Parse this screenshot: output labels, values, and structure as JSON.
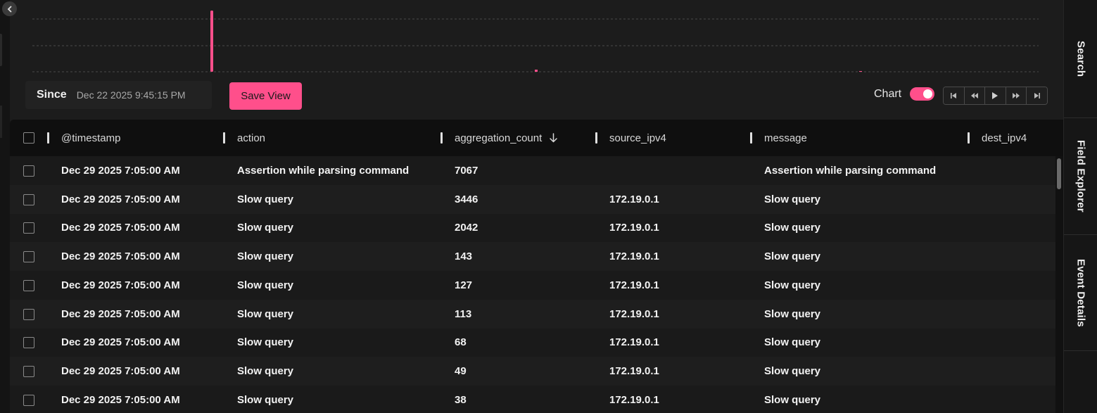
{
  "right_panel": {
    "tabs": [
      "Search",
      "Field Explorer",
      "Event Details"
    ]
  },
  "toolbar": {
    "since_label": "Since",
    "since_value": "Dec 22 2025 9:45:15 PM",
    "save_view_label": "Save View",
    "chart_label": "Chart",
    "chart_enabled": true,
    "player_controls": [
      "skip-back-icon",
      "rewind-icon",
      "play-icon",
      "fast-forward-icon",
      "skip-forward-icon"
    ]
  },
  "colors": {
    "accent": "#ff4f8b",
    "background": "#1c1c1c",
    "header_bg": "#0f0f0f"
  },
  "table": {
    "columns": [
      "@timestamp",
      "action",
      "aggregation_count",
      "source_ipv4",
      "message",
      "dest_ipv4"
    ],
    "sorted_column": "aggregation_count",
    "sort_direction": "descending",
    "rows": [
      {
        "timestamp": "Dec 29 2025 7:05:00 AM",
        "action": "Assertion while parsing command",
        "aggregation_count": "7067",
        "source_ipv4": "",
        "message": "Assertion while parsing command",
        "dest_ipv4": ""
      },
      {
        "timestamp": "Dec 29 2025 7:05:00 AM",
        "action": "Slow query",
        "aggregation_count": "3446",
        "source_ipv4": "172.19.0.1",
        "message": "Slow query",
        "dest_ipv4": ""
      },
      {
        "timestamp": "Dec 29 2025 7:05:00 AM",
        "action": "Slow query",
        "aggregation_count": "2042",
        "source_ipv4": "172.19.0.1",
        "message": "Slow query",
        "dest_ipv4": ""
      },
      {
        "timestamp": "Dec 29 2025 7:05:00 AM",
        "action": "Slow query",
        "aggregation_count": "143",
        "source_ipv4": "172.19.0.1",
        "message": "Slow query",
        "dest_ipv4": ""
      },
      {
        "timestamp": "Dec 29 2025 7:05:00 AM",
        "action": "Slow query",
        "aggregation_count": "127",
        "source_ipv4": "172.19.0.1",
        "message": "Slow query",
        "dest_ipv4": ""
      },
      {
        "timestamp": "Dec 29 2025 7:05:00 AM",
        "action": "Slow query",
        "aggregation_count": "113",
        "source_ipv4": "172.19.0.1",
        "message": "Slow query",
        "dest_ipv4": ""
      },
      {
        "timestamp": "Dec 29 2025 7:05:00 AM",
        "action": "Slow query",
        "aggregation_count": "68",
        "source_ipv4": "172.19.0.1",
        "message": "Slow query",
        "dest_ipv4": ""
      },
      {
        "timestamp": "Dec 29 2025 7:05:00 AM",
        "action": "Slow query",
        "aggregation_count": "49",
        "source_ipv4": "172.19.0.1",
        "message": "Slow query",
        "dest_ipv4": ""
      },
      {
        "timestamp": "Dec 29 2025 7:05:00 AM",
        "action": "Slow query",
        "aggregation_count": "38",
        "source_ipv4": "172.19.0.1",
        "message": "Slow query",
        "dest_ipv4": ""
      }
    ]
  }
}
